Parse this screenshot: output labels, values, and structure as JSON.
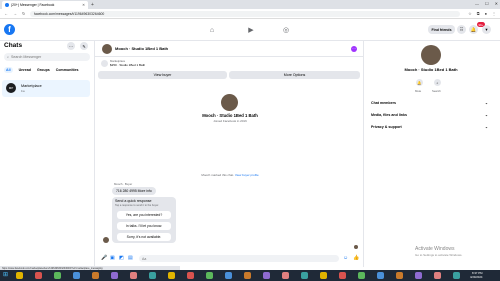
{
  "browser": {
    "tab_title": "(20+) Messenger | Facebook",
    "url": "facebook.com/messages/t/1196496303264600",
    "icons": [
      "back-icon",
      "forward-icon",
      "reload-icon",
      "home-icon"
    ]
  },
  "fb_header": {
    "find_friends": "Find friends",
    "notif_badge": "99+"
  },
  "left": {
    "title": "Chats",
    "search_placeholder": "Search Messenger",
    "filters": [
      "All",
      "Unread",
      "Groups",
      "Communities"
    ],
    "conversation": {
      "name": "Marketplace",
      "sub": "1w",
      "avatar_text": "MP"
    }
  },
  "chat": {
    "header_name": "Mooch · Studio 1Bed 1 Bath",
    "banner_line1": "Marketplace",
    "banner_line2": "$250 · Studio 1Bed 1 Bath",
    "view_buyer": "View buyer",
    "more_options": "More Options",
    "profile_name": "Mooch · Studio 1Bed 1 Bath",
    "profile_joined": "Joined Facebook in 2016",
    "marked_note": "Mooch marked this chat.",
    "marked_link": "View buyer profile",
    "sender_label": "Mooch · Buyer",
    "message": "716 280 4995 More info",
    "quick_reply_title": "Send a quick response",
    "quick_reply_sub": "Tap a response to send it to the buyer.",
    "quick_replies": [
      "Yes, are you interested?",
      "In talks. I'll let you know.",
      "Sorry, it's not available."
    ],
    "input_placeholder": "Aa"
  },
  "right": {
    "name": "Mooch · Studio 1Bed 1 Bath",
    "actions": [
      "Mute",
      "Search"
    ],
    "sections": [
      "Chat members",
      "Media, files and links",
      "Privacy & support"
    ]
  },
  "watermark": {
    "line1": "Activate Windows",
    "line2": "Go to Settings to activate Windows."
  },
  "status_url": "https://www.facebook.com/marketplace/item/1196496303264600/?ref=marketplace_messaging",
  "clock": {
    "time": "8:37 PM",
    "date": "4/29/2024"
  }
}
